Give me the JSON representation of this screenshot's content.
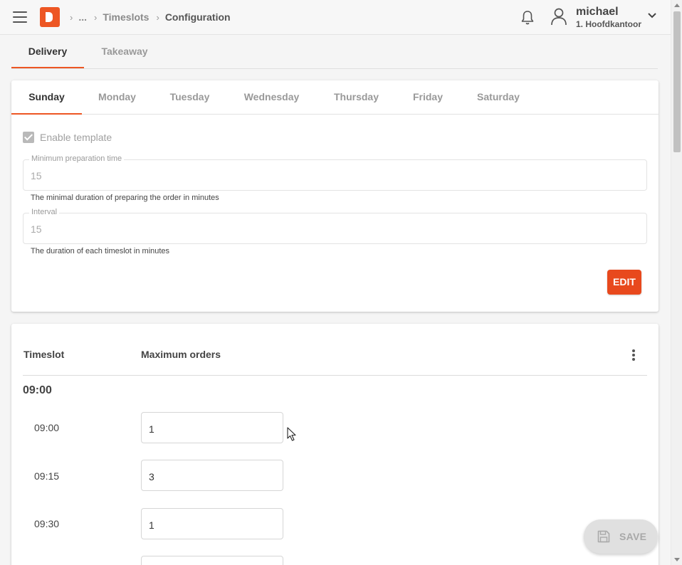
{
  "header": {
    "breadcrumb": [
      "...",
      "Timeslots",
      "Configuration"
    ],
    "user_name": "michael",
    "user_location": "1. Hoofdkantoor"
  },
  "top_tabs": [
    "Delivery",
    "Takeaway"
  ],
  "day_tabs": [
    "Sunday",
    "Monday",
    "Tuesday",
    "Wednesday",
    "Thursday",
    "Friday",
    "Saturday"
  ],
  "template": {
    "enable_label": "Enable template",
    "enabled": true,
    "min_prep_label": "Minimum preparation time",
    "min_prep_value": "15",
    "min_prep_helper": "The minimal duration of preparing the order in minutes",
    "interval_label": "Interval",
    "interval_value": "15",
    "interval_helper": "The duration of each timeslot in minutes",
    "edit_label": "EDIT"
  },
  "timeslot_table": {
    "col_timeslot": "Timeslot",
    "col_max_orders": "Maximum orders",
    "group": "09:00",
    "rows": [
      {
        "time": "09:00",
        "value": "1"
      },
      {
        "time": "09:15",
        "value": "3"
      },
      {
        "time": "09:30",
        "value": "1"
      }
    ]
  },
  "save_label": "SAVE",
  "colors": {
    "accent": "#ed5623",
    "edit_button": "#e8491d"
  },
  "icons": [
    "menu-icon",
    "logo-icon",
    "chevron-right-icon",
    "bell-icon",
    "user-icon",
    "chevron-down-icon",
    "more-vertical-icon",
    "save-icon"
  ]
}
